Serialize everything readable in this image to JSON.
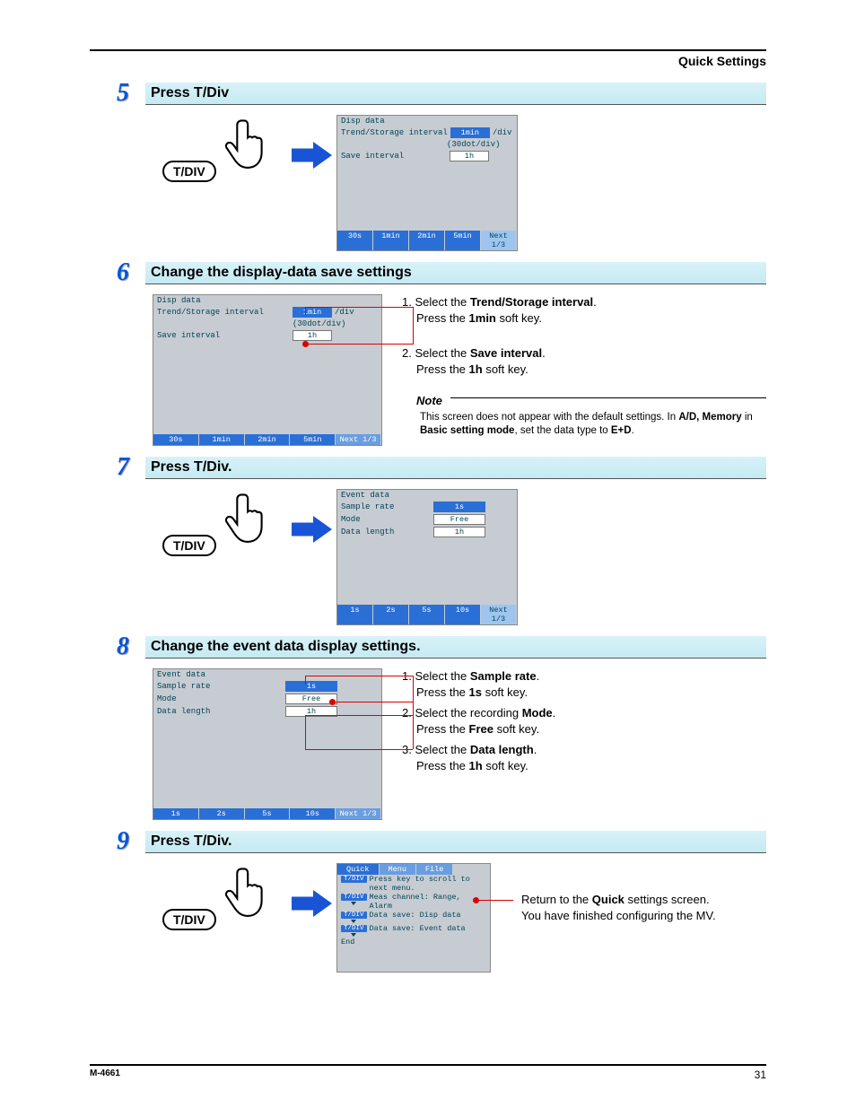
{
  "header": {
    "section_title": "Quick Settings"
  },
  "steps": {
    "s5": {
      "num": "5",
      "title": "Press T/Div",
      "button": "T/DIV"
    },
    "s6": {
      "num": "6",
      "title": "Change the display-data save settings"
    },
    "s7": {
      "num": "7",
      "title": "Press T/Div.",
      "button": "T/DIV"
    },
    "s8": {
      "num": "8",
      "title": "Change the event data display settings."
    },
    "s9": {
      "num": "9",
      "title": "Press T/Div.",
      "button": "T/DIV"
    }
  },
  "disp_screen": {
    "title": "Disp data",
    "row1_label": "Trend/Storage interval",
    "row1_value": "1min",
    "row1_unit": "/div",
    "row1_sub": "(30dot/div)",
    "row2_label": "Save interval",
    "row2_value": "1h",
    "softkeys": [
      "30s",
      "1min",
      "2min",
      "5min",
      "Next 1/3"
    ]
  },
  "event_screen": {
    "title": "Event data",
    "r1_label": "Sample rate",
    "r1_value": "1s",
    "r2_label": "Mode",
    "r2_value": "Free",
    "r3_label": "Data length",
    "r3_value": "1h",
    "softkeys": [
      "1s",
      "2s",
      "5s",
      "10s",
      "Next 1/3"
    ]
  },
  "quick_menu": {
    "tabs": {
      "t1": "Quick",
      "t2": "Menu",
      "t3": "File"
    },
    "hint_btn": "T/DIV",
    "hint": "Press key to scroll to next menu.",
    "i1_btn": "T/DIV",
    "i1": "Meas channel: Range, Alarm",
    "i2_btn": "T/DIV",
    "i2": "Data save: Disp data",
    "i3_btn": "T/DIV",
    "i3": "Data save: Event data",
    "end": "End"
  },
  "instr6": {
    "l1a": "1. Select the ",
    "l1b": "Trend/Storage interval",
    "l1c": ".",
    "l2a": "Press the ",
    "l2b": "1min",
    "l2c": " soft key.",
    "l3a": "2. Select the ",
    "l3b": "Save interval",
    "l3c": ".",
    "l4a": "Press the ",
    "l4b": "1h",
    "l4c": " soft key.",
    "note_label": "Note",
    "note_t1": "This screen does not appear with the default settings. In ",
    "note_b1": "A/D, ",
    "note_b2": "Memory",
    "note_t2": " in ",
    "note_b3": "Basic setting mode",
    "note_t3": ", set the data type to ",
    "note_b4": "E+D",
    "note_t4": "."
  },
  "instr8": {
    "l1a": "1. Select the ",
    "l1b": "Sample rate",
    "l1c": ".",
    "l2a": "Press the ",
    "l2b": "1s",
    "l2c": " soft key.",
    "l3a": "2. Select the recording ",
    "l3b": "Mode",
    "l3c": ".",
    "l4a": "Press the ",
    "l4b": "Free",
    "l4c": " soft key.",
    "l5a": "3. Select the ",
    "l5b": "Data length",
    "l5c": ".",
    "l6a": "Press the ",
    "l6b": "1h",
    "l6c": " soft key."
  },
  "instr9": {
    "l1a": "Return to the ",
    "l1b": "Quick",
    "l1c": " settings screen.",
    "l2": "You have finished configuring the MV."
  },
  "footer": {
    "left": "M-4661",
    "right": "31"
  }
}
